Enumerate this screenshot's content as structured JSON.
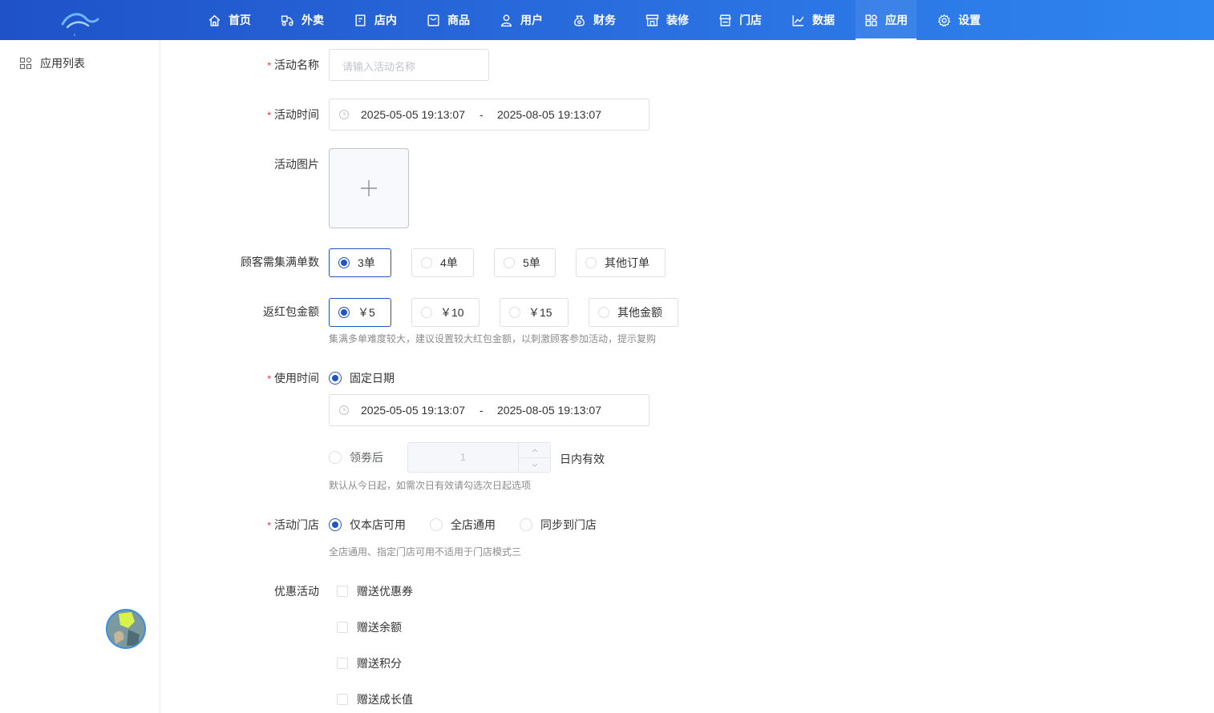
{
  "nav": {
    "items": [
      {
        "label": "首页",
        "icon": "home-icon"
      },
      {
        "label": "外卖",
        "icon": "delivery-icon"
      },
      {
        "label": "店内",
        "icon": "dine-in-icon"
      },
      {
        "label": "商品",
        "icon": "goods-icon"
      },
      {
        "label": "用户",
        "icon": "user-icon"
      },
      {
        "label": "财务",
        "icon": "finance-icon"
      },
      {
        "label": "装修",
        "icon": "decorate-icon"
      },
      {
        "label": "门店",
        "icon": "store-icon"
      },
      {
        "label": "数据",
        "icon": "chart-icon"
      },
      {
        "label": "应用",
        "icon": "apps-icon"
      },
      {
        "label": "设置",
        "icon": "gear-icon"
      }
    ],
    "active": "应用"
  },
  "sidebar": {
    "items": [
      {
        "label": "应用列表",
        "icon": "apps-icon"
      }
    ]
  },
  "form": {
    "activity_name": {
      "label": "活动名称",
      "required": true,
      "placeholder": "请输入活动名称",
      "value": ""
    },
    "activity_time": {
      "label": "活动时间",
      "required": true,
      "start": "2025-05-05 19:13:07",
      "separator": "-",
      "end": "2025-08-05 19:13:07"
    },
    "activity_image": {
      "label": "活动图片",
      "required": false
    },
    "orders_needed": {
      "label": "顾客需集满单数",
      "options": [
        "3单",
        "4单",
        "5单",
        "其他订单"
      ],
      "selected": "3单"
    },
    "red_packet": {
      "label": "返红包金额",
      "options": [
        "￥5",
        "￥10",
        "￥15",
        "其他金额"
      ],
      "selected": "￥5",
      "hint": "集满多单难度较大，建议设置较大红包金额，以刺激顾客参加活动，提示复购"
    },
    "use_time": {
      "label": "使用时间",
      "required": true,
      "fixed_label": "固定日期",
      "fixed_selected": true,
      "start": "2025-05-05 19:13:07",
      "separator": "-",
      "end": "2025-08-05 19:13:07",
      "after_label": "领劵后",
      "days_value": "1",
      "days_suffix": "日内有效",
      "hint": "默认从今日起，如需次日有效请勾选次日起选项"
    },
    "store": {
      "label": "活动门店",
      "required": true,
      "options": [
        "仅本店可用",
        "全店通用",
        "同步到门店"
      ],
      "selected": "仅本店可用",
      "hint": "全店通用、指定门店可用不适用于门店模式三"
    },
    "promotions": {
      "label": "优惠活动",
      "options": [
        "赠送优惠券",
        "赠送余额",
        "赠送积分",
        "赠送成长值"
      ]
    }
  },
  "colors": {
    "primary": "#2155c6",
    "required": "#f5222d",
    "topbar_start": "#1f52c8",
    "topbar_end": "#2e86f0"
  }
}
